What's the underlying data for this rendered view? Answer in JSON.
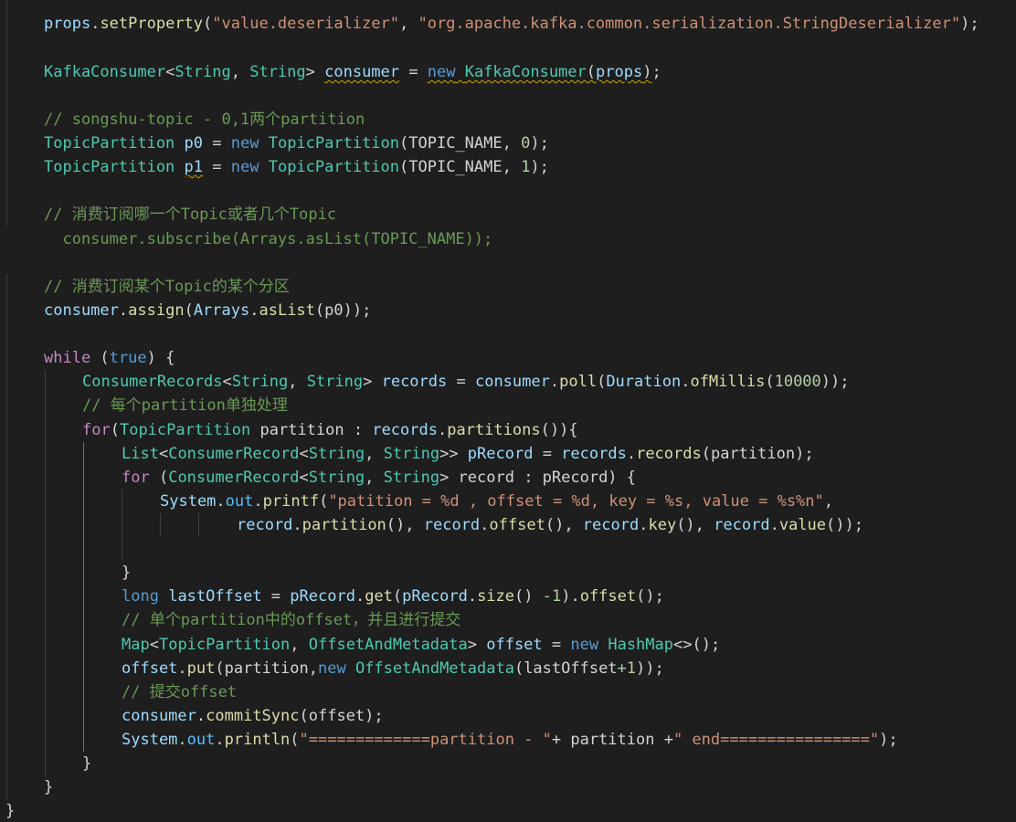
{
  "colors": {
    "background": "#1e1e1e",
    "plain": "#d4d4d4",
    "keyword": "#569cd6",
    "control": "#c586c0",
    "type": "#4ec9b0",
    "variable": "#9cdcfe",
    "function": "#dcdcaa",
    "string": "#ce9178",
    "number": "#b5cea8",
    "comment": "#6a9955",
    "constant": "#4fc1ff"
  },
  "code_lines": [
    {
      "tokens": [
        {
          "t": "props",
          "c": "variable"
        },
        {
          "t": ".",
          "c": "plain"
        },
        {
          "t": "setProperty",
          "c": "function"
        },
        {
          "t": "(",
          "c": "plain"
        },
        {
          "t": "\"value.deserializer\"",
          "c": "string"
        },
        {
          "t": ", ",
          "c": "plain"
        },
        {
          "t": "\"org.apache.kafka.common.serialization.StringDeserializer\"",
          "c": "string"
        },
        {
          "t": ");",
          "c": "plain"
        }
      ]
    },
    {
      "tokens": []
    },
    {
      "tokens": [
        {
          "t": "KafkaConsumer",
          "c": "type"
        },
        {
          "t": "<",
          "c": "plain"
        },
        {
          "t": "String",
          "c": "type"
        },
        {
          "t": ", ",
          "c": "plain"
        },
        {
          "t": "String",
          "c": "type"
        },
        {
          "t": "> ",
          "c": "plain"
        },
        {
          "t": "consumer",
          "c": "variable",
          "squiggle": true
        },
        {
          "t": " = ",
          "c": "plain"
        },
        {
          "t": "new KafkaConsumer(props)",
          "c": "mixed-new",
          "squiggle": true
        },
        {
          "t": ";",
          "c": "plain"
        }
      ]
    },
    {
      "tokens": []
    },
    {
      "tokens": [
        {
          "t": "// songshu-topic - 0,1两个partition",
          "c": "comment"
        }
      ]
    },
    {
      "tokens": [
        {
          "t": "TopicPartition",
          "c": "type"
        },
        {
          "t": " ",
          "c": "plain"
        },
        {
          "t": "p0",
          "c": "variable"
        },
        {
          "t": " = ",
          "c": "plain"
        },
        {
          "t": "new",
          "c": "keyword"
        },
        {
          "t": " ",
          "c": "plain"
        },
        {
          "t": "TopicPartition",
          "c": "type"
        },
        {
          "t": "(TOPIC_NAME, ",
          "c": "plain"
        },
        {
          "t": "0",
          "c": "number"
        },
        {
          "t": ");",
          "c": "plain"
        }
      ]
    },
    {
      "tokens": [
        {
          "t": "TopicPartition",
          "c": "type"
        },
        {
          "t": " ",
          "c": "plain"
        },
        {
          "t": "p1",
          "c": "variable",
          "squiggle": true
        },
        {
          "t": " = ",
          "c": "plain"
        },
        {
          "t": "new",
          "c": "keyword"
        },
        {
          "t": " ",
          "c": "plain"
        },
        {
          "t": "TopicPartition",
          "c": "type"
        },
        {
          "t": "(TOPIC_NAME, ",
          "c": "plain"
        },
        {
          "t": "1",
          "c": "number"
        },
        {
          "t": ");",
          "c": "plain"
        }
      ]
    },
    {
      "tokens": []
    },
    {
      "tokens": [
        {
          "t": "// 消费订阅哪一个Topic或者几个Topic",
          "c": "comment"
        }
      ]
    },
    {
      "tokens": [
        {
          "t": "  consumer.subscribe(Arrays.asList(TOPIC_NAME));",
          "c": "comment"
        }
      ]
    },
    {
      "tokens": []
    },
    {
      "tokens": [
        {
          "t": "// 消费订阅某个Topic的某个分区",
          "c": "comment"
        }
      ]
    },
    {
      "tokens": [
        {
          "t": "consumer",
          "c": "variable"
        },
        {
          "t": ".",
          "c": "plain"
        },
        {
          "t": "assign",
          "c": "function"
        },
        {
          "t": "(",
          "c": "plain"
        },
        {
          "t": "Arrays",
          "c": "variable"
        },
        {
          "t": ".",
          "c": "plain"
        },
        {
          "t": "asList",
          "c": "function"
        },
        {
          "t": "(p0));",
          "c": "plain"
        }
      ]
    },
    {
      "tokens": []
    },
    {
      "tokens": [
        {
          "t": "while",
          "c": "control"
        },
        {
          "t": " (",
          "c": "plain"
        },
        {
          "t": "true",
          "c": "keyword"
        },
        {
          "t": ") {",
          "c": "plain"
        }
      ]
    },
    {
      "tokens": [
        {
          "t": "ConsumerRecords",
          "c": "type"
        },
        {
          "t": "<",
          "c": "plain"
        },
        {
          "t": "String",
          "c": "type"
        },
        {
          "t": ", ",
          "c": "plain"
        },
        {
          "t": "String",
          "c": "type"
        },
        {
          "t": "> ",
          "c": "plain"
        },
        {
          "t": "records",
          "c": "variable"
        },
        {
          "t": " = ",
          "c": "plain"
        },
        {
          "t": "consumer",
          "c": "variable"
        },
        {
          "t": ".",
          "c": "plain"
        },
        {
          "t": "poll",
          "c": "function"
        },
        {
          "t": "(",
          "c": "plain"
        },
        {
          "t": "Duration",
          "c": "variable"
        },
        {
          "t": ".",
          "c": "plain"
        },
        {
          "t": "ofMillis",
          "c": "function"
        },
        {
          "t": "(",
          "c": "plain"
        },
        {
          "t": "10000",
          "c": "number"
        },
        {
          "t": "));",
          "c": "plain"
        }
      ]
    },
    {
      "tokens": [
        {
          "t": "// 每个partition单独处理",
          "c": "comment"
        }
      ]
    },
    {
      "tokens": [
        {
          "t": "for",
          "c": "control"
        },
        {
          "t": "(",
          "c": "plain"
        },
        {
          "t": "TopicPartition",
          "c": "type"
        },
        {
          "t": " partition : ",
          "c": "plain"
        },
        {
          "t": "records",
          "c": "variable"
        },
        {
          "t": ".",
          "c": "plain"
        },
        {
          "t": "partitions",
          "c": "function"
        },
        {
          "t": "()){",
          "c": "plain"
        }
      ]
    },
    {
      "tokens": [
        {
          "t": "List",
          "c": "type"
        },
        {
          "t": "<",
          "c": "plain"
        },
        {
          "t": "ConsumerRecord",
          "c": "type"
        },
        {
          "t": "<",
          "c": "plain"
        },
        {
          "t": "String",
          "c": "type"
        },
        {
          "t": ", ",
          "c": "plain"
        },
        {
          "t": "String",
          "c": "type"
        },
        {
          "t": ">> ",
          "c": "plain"
        },
        {
          "t": "pRecord",
          "c": "variable"
        },
        {
          "t": " = ",
          "c": "plain"
        },
        {
          "t": "records",
          "c": "variable"
        },
        {
          "t": ".",
          "c": "plain"
        },
        {
          "t": "records",
          "c": "function"
        },
        {
          "t": "(partition);",
          "c": "plain"
        }
      ]
    },
    {
      "tokens": [
        {
          "t": "for",
          "c": "control"
        },
        {
          "t": " (",
          "c": "plain"
        },
        {
          "t": "ConsumerRecord",
          "c": "type"
        },
        {
          "t": "<",
          "c": "plain"
        },
        {
          "t": "String",
          "c": "type"
        },
        {
          "t": ", ",
          "c": "plain"
        },
        {
          "t": "String",
          "c": "type"
        },
        {
          "t": "> record : pRecord) {",
          "c": "plain"
        }
      ]
    },
    {
      "tokens": [
        {
          "t": "System",
          "c": "variable"
        },
        {
          "t": ".",
          "c": "plain"
        },
        {
          "t": "out",
          "c": "constant"
        },
        {
          "t": ".",
          "c": "plain"
        },
        {
          "t": "printf",
          "c": "function"
        },
        {
          "t": "(",
          "c": "plain"
        },
        {
          "t": "\"patition = %d , offset = %d, key = %s, value = %s%n\"",
          "c": "string"
        },
        {
          "t": ",",
          "c": "plain"
        }
      ]
    },
    {
      "tokens": [
        {
          "t": "record",
          "c": "variable"
        },
        {
          "t": ".",
          "c": "plain"
        },
        {
          "t": "partition",
          "c": "function"
        },
        {
          "t": "(), ",
          "c": "plain"
        },
        {
          "t": "record",
          "c": "variable"
        },
        {
          "t": ".",
          "c": "plain"
        },
        {
          "t": "offset",
          "c": "function"
        },
        {
          "t": "(), ",
          "c": "plain"
        },
        {
          "t": "record",
          "c": "variable"
        },
        {
          "t": ".",
          "c": "plain"
        },
        {
          "t": "key",
          "c": "function"
        },
        {
          "t": "(), ",
          "c": "plain"
        },
        {
          "t": "record",
          "c": "variable"
        },
        {
          "t": ".",
          "c": "plain"
        },
        {
          "t": "value",
          "c": "function"
        },
        {
          "t": "());",
          "c": "plain"
        }
      ]
    },
    {
      "tokens": []
    },
    {
      "tokens": [
        {
          "t": "}",
          "c": "plain"
        }
      ]
    },
    {
      "tokens": [
        {
          "t": "long",
          "c": "keyword"
        },
        {
          "t": " ",
          "c": "plain"
        },
        {
          "t": "lastOffset",
          "c": "variable"
        },
        {
          "t": " = ",
          "c": "plain"
        },
        {
          "t": "pRecord",
          "c": "variable"
        },
        {
          "t": ".",
          "c": "plain"
        },
        {
          "t": "get",
          "c": "function"
        },
        {
          "t": "(",
          "c": "plain"
        },
        {
          "t": "pRecord",
          "c": "variable"
        },
        {
          "t": ".",
          "c": "plain"
        },
        {
          "t": "size",
          "c": "function"
        },
        {
          "t": "() ",
          "c": "plain"
        },
        {
          "t": "-1",
          "c": "number"
        },
        {
          "t": ").",
          "c": "plain"
        },
        {
          "t": "offset",
          "c": "function"
        },
        {
          "t": "();",
          "c": "plain"
        }
      ]
    },
    {
      "tokens": [
        {
          "t": "// 单个partition中的offset，并且进行提交",
          "c": "comment"
        }
      ]
    },
    {
      "tokens": [
        {
          "t": "Map",
          "c": "type"
        },
        {
          "t": "<",
          "c": "plain"
        },
        {
          "t": "TopicPartition",
          "c": "type"
        },
        {
          "t": ", ",
          "c": "plain"
        },
        {
          "t": "OffsetAndMetadata",
          "c": "type"
        },
        {
          "t": "> ",
          "c": "plain"
        },
        {
          "t": "offset",
          "c": "variable"
        },
        {
          "t": " = ",
          "c": "plain"
        },
        {
          "t": "new",
          "c": "keyword"
        },
        {
          "t": " ",
          "c": "plain"
        },
        {
          "t": "HashMap",
          "c": "type"
        },
        {
          "t": "<>();",
          "c": "plain"
        }
      ]
    },
    {
      "tokens": [
        {
          "t": "offset",
          "c": "variable"
        },
        {
          "t": ".",
          "c": "plain"
        },
        {
          "t": "put",
          "c": "function"
        },
        {
          "t": "(partition,",
          "c": "plain"
        },
        {
          "t": "new",
          "c": "keyword"
        },
        {
          "t": " ",
          "c": "plain"
        },
        {
          "t": "OffsetAndMetadata",
          "c": "type"
        },
        {
          "t": "(lastOffset",
          "c": "plain"
        },
        {
          "t": "+1",
          "c": "number"
        },
        {
          "t": "));",
          "c": "plain"
        }
      ]
    },
    {
      "tokens": [
        {
          "t": "// 提交offset",
          "c": "comment"
        }
      ]
    },
    {
      "tokens": [
        {
          "t": "consumer",
          "c": "variable"
        },
        {
          "t": ".",
          "c": "plain"
        },
        {
          "t": "commitSync",
          "c": "function"
        },
        {
          "t": "(offset);",
          "c": "plain"
        }
      ]
    },
    {
      "tokens": [
        {
          "t": "System",
          "c": "variable"
        },
        {
          "t": ".",
          "c": "plain"
        },
        {
          "t": "out",
          "c": "constant"
        },
        {
          "t": ".",
          "c": "plain"
        },
        {
          "t": "println",
          "c": "function"
        },
        {
          "t": "(",
          "c": "plain"
        },
        {
          "t": "\"=============partition - \"",
          "c": "string"
        },
        {
          "t": "+ partition +",
          "c": "plain"
        },
        {
          "t": "\" end================\"",
          "c": "string"
        },
        {
          "t": ");",
          "c": "plain"
        }
      ]
    },
    {
      "tokens": [
        {
          "t": "}",
          "c": "plain"
        }
      ]
    },
    {
      "tokens": [
        {
          "t": "}",
          "c": "plain"
        }
      ]
    },
    {
      "tokens": [
        {
          "t": "}",
          "c": "plain"
        }
      ]
    }
  ]
}
